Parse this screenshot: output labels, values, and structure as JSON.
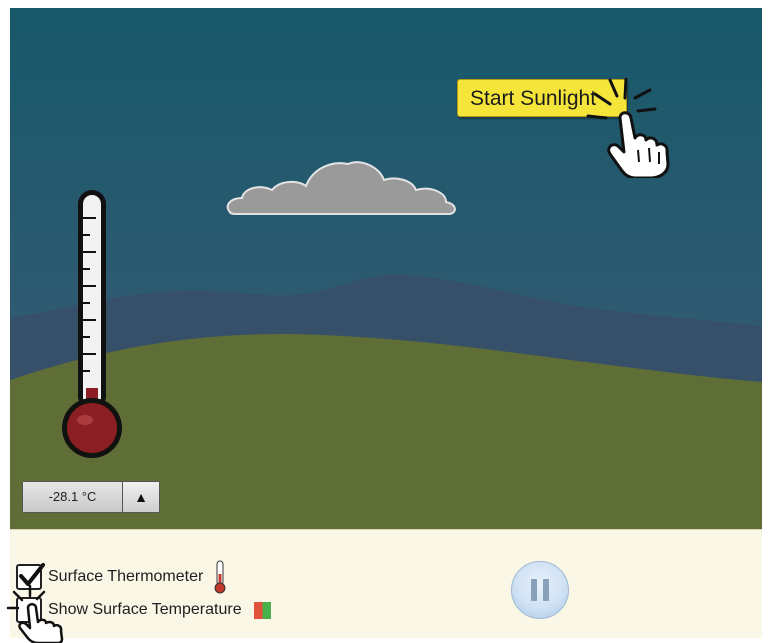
{
  "scene": {
    "start_sunlight_label": "Start Sunlight",
    "thermometer_readout": "-28.1 °C",
    "readout_arrow": "▲"
  },
  "controls": {
    "surface_thermometer_label": "Surface Thermometer",
    "surface_thermometer_checked": true,
    "show_surface_temperature_label": "Show Surface Temperature",
    "show_surface_temperature_checked": false,
    "playback_state": "playing"
  },
  "colors": {
    "sky_top": "#175869",
    "sky_bottom": "#3d5a78",
    "mountains": "#36506a",
    "ground": "#5f6d36",
    "cloud": "#9a9a9a",
    "thermometer_bulb": "#8c1f24",
    "button_yellow": "#f5e53a",
    "panel": "#fbf7e7"
  },
  "icons": {
    "pointer_top": "hand-pointer-icon",
    "pointer_bottom": "hand-pointer-icon",
    "checkmark": "checkmark-icon",
    "pause": "pause-icon",
    "mini_thermometer": "thermometer-icon",
    "temperature_swatch": "color-swatch-icon",
    "increment": "up-arrow-icon"
  }
}
